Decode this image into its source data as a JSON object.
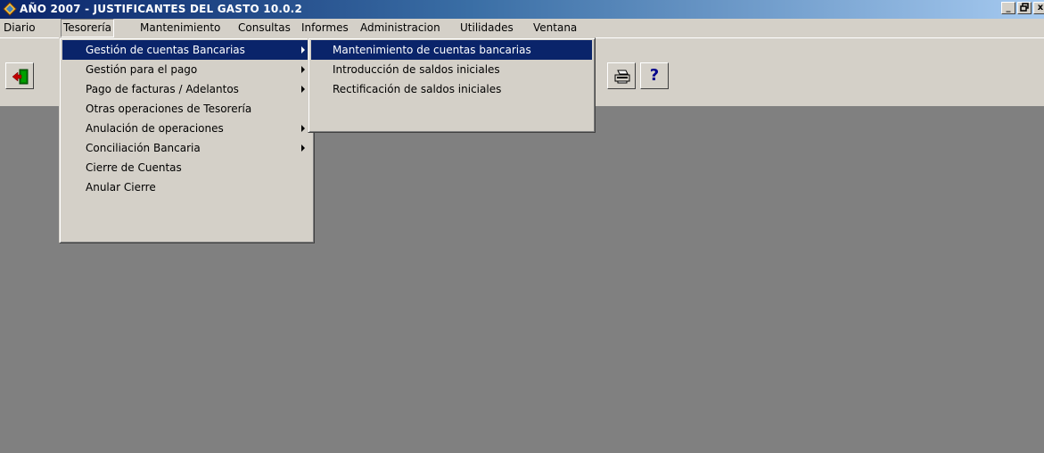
{
  "window": {
    "title": "AÑO 2007 - JUSTIFICANTES DEL GASTO 10.0.2",
    "minimize": "_",
    "restore": "̥",
    "close": "x"
  },
  "menubar": {
    "items": [
      "Diario",
      "Tesorería",
      "Mantenimiento",
      "Consultas",
      "Informes",
      "Administracion",
      "Utilidades",
      "Ventana"
    ],
    "active": "Tesorería"
  },
  "toolbar": {
    "exit_icon": "exit-door-icon",
    "print_icon": "printer-icon",
    "help_label": "?"
  },
  "tesoreria_menu": {
    "items": [
      {
        "label": "Gestión de cuentas Bancarias",
        "submenu": true,
        "highlighted": true
      },
      {
        "label": "Gestión para el pago",
        "submenu": true
      },
      {
        "label": "Pago de facturas / Adelantos",
        "submenu": true
      },
      {
        "label": "Otras operaciones de Tesorería",
        "submenu": false
      },
      {
        "label": "Anulación de operaciones",
        "submenu": true
      },
      {
        "label": "Conciliación Bancaria",
        "submenu": true
      },
      {
        "label": "Cierre de Cuentas",
        "submenu": false
      },
      {
        "label": "Anular Cierre",
        "submenu": false
      }
    ]
  },
  "cuentas_submenu": {
    "items": [
      {
        "label": "Mantenimiento de cuentas bancarias",
        "highlighted": true
      },
      {
        "label": "Introducción de saldos iniciales"
      },
      {
        "label": "Rectificación de saldos iniciales"
      }
    ]
  },
  "colors": {
    "title_start": "#0a246a",
    "title_end": "#a6caf0",
    "highlight": "#0a246a",
    "face": "#d4d0c8",
    "workspace": "#808080"
  }
}
